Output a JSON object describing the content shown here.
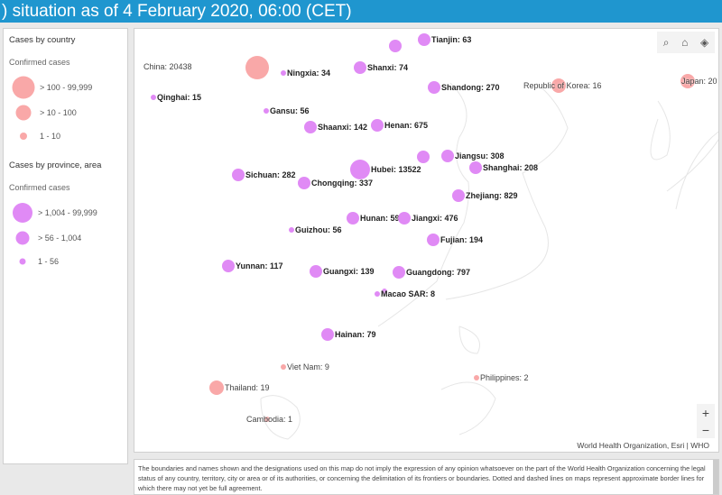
{
  "header": {
    "title": ") situation as of 4 February 2020, 06:00 (CET)"
  },
  "legend": {
    "country": {
      "title": "Cases by country",
      "subtitle": "Confirmed cases",
      "color": "#f9a8a8",
      "classes": [
        "> 100 - 99,999",
        "> 10 - 100",
        "1 - 10"
      ]
    },
    "province": {
      "title": "Cases by province, area",
      "subtitle": "Confirmed cases",
      "color": "#e08af5",
      "classes": [
        "> 1,004 - 99,999",
        "> 56 - 1,004",
        "1 - 56"
      ]
    }
  },
  "map": {
    "labels": {
      "china": "China: 20438",
      "ningxia": "Ningxia: 34",
      "tianjin": "Tianjin: 63",
      "shanxi": "Shanxi: 74",
      "shandong": "Shandong: 270",
      "korea": "Republic of Korea: 16",
      "japan": "Japan: 20",
      "qinghai": "Qinghai: 15",
      "gansu": "Gansu: 56",
      "shaanxi": "Shaanxi: 142",
      "henan": "Henan: 675",
      "jiangsu": "Jiangsu: 308",
      "shanghai": "Shanghai: 208",
      "hubei": "Hubei: 13522",
      "sichuan": "Sichuan: 282",
      "chongqing": "Chongqing: 337",
      "zhejiang": "Zhejiang: 829",
      "hunan": "Hunan: 593",
      "jiangxi": "Jiangxi: 476",
      "fujian": "Fujian: 194",
      "guizhou": "Guizhou: 56",
      "yunnan": "Yunnan: 117",
      "guangxi": "Guangxi: 139",
      "guangdong": "Guangdong: 797",
      "macao": "Macao SAR: 8",
      "hainan": "Hainan: 79",
      "vietnam": "Viet Nam: 9",
      "thailand": "Thailand: 19",
      "philippines": "Philippines: 2",
      "cambodia": "Cambodia: 1"
    },
    "tools": {
      "search": "search-icon",
      "home": "home-icon",
      "layers": "layers-icon"
    },
    "zoom_in": "+",
    "zoom_out": "−",
    "attribution": "World Health Organization, Esri | WHO"
  },
  "disclaimer": "The boundaries and names shown and the designations used on this map do not imply the expression of any opinion whatsoever on the part of the World Health Organization concerning the legal status of any country, territory, city or area or of its authorities, or concerning the delimitation of its frontiers or boundaries. Dotted and dashed lines on maps represent approximate border lines for which there may not yet be full agreement."
}
